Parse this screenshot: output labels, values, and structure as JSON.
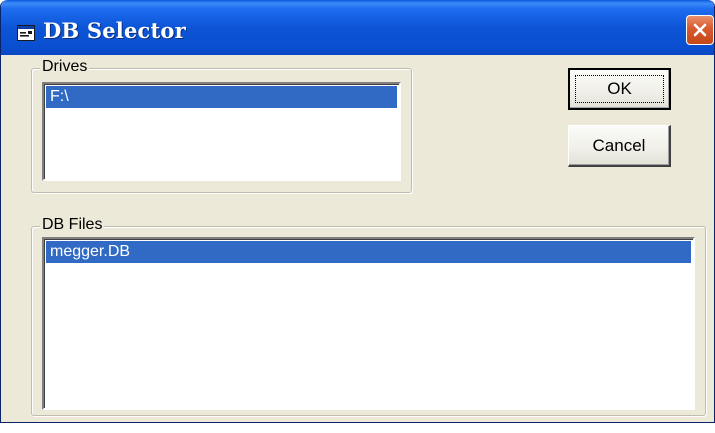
{
  "window": {
    "title": "DB Selector",
    "close_icon": "close-x-icon",
    "app_icon": "dialog-icon"
  },
  "drives": {
    "label": "Drives",
    "items": [
      "F:\\"
    ],
    "selected_index": 0
  },
  "db_files": {
    "label": "DB Files",
    "items": [
      "megger.DB"
    ],
    "selected_index": 0
  },
  "buttons": {
    "ok_label": "OK",
    "cancel_label": "Cancel"
  },
  "colors": {
    "titlebar": "#0c55d6",
    "selection": "#316ac5",
    "dialog_bg": "#ece9d8",
    "close_button": "#d85a30"
  }
}
